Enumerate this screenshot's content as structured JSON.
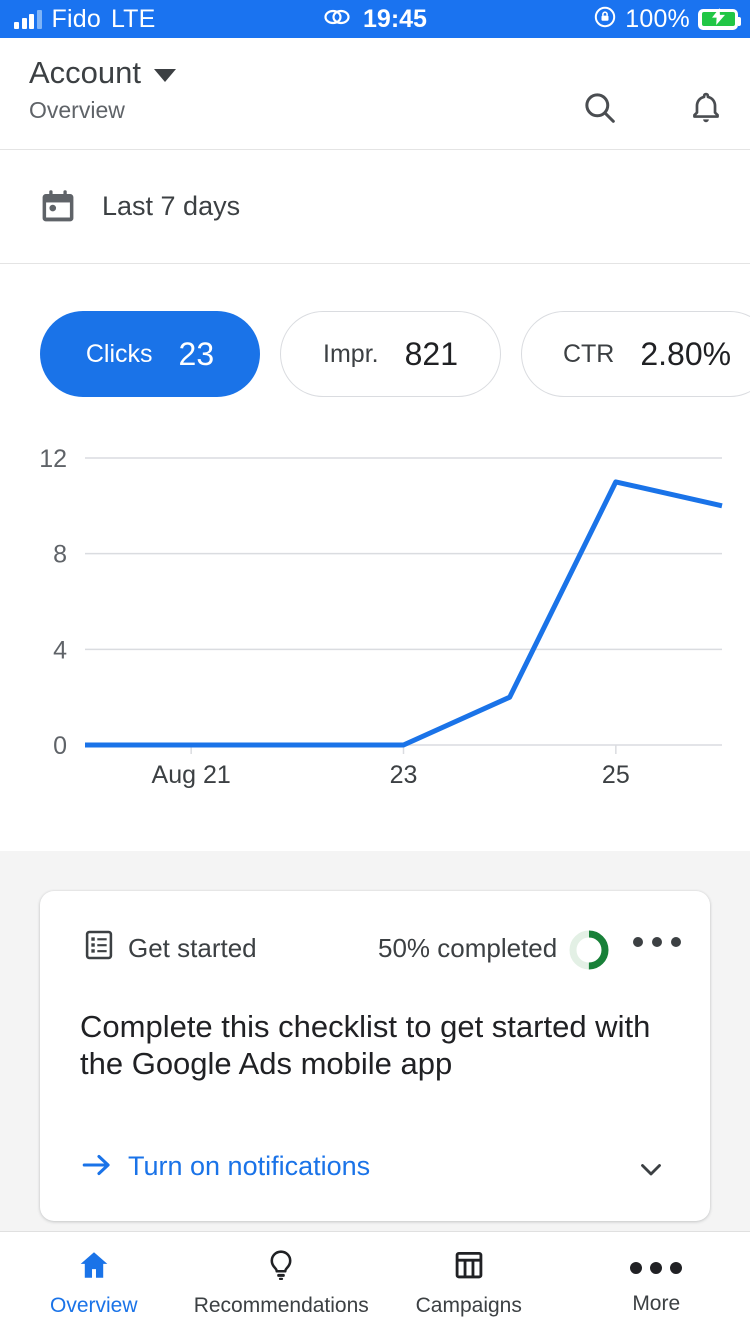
{
  "status_bar": {
    "carrier": "Fido",
    "network": "LTE",
    "time": "19:45",
    "battery_percent": "100%",
    "signal_icon": "signal-bars-icon",
    "link_icon": "link-icon",
    "rotation_lock_icon": "rotation-lock-icon",
    "battery_icon": "battery-charging-icon",
    "background_color": "#1a73f0"
  },
  "header": {
    "title": "Account",
    "subtitle": "Overview",
    "dropdown_icon": "chevron-down-icon",
    "search_icon": "search-icon",
    "notifications_icon": "bell-icon"
  },
  "date_range": {
    "label": "Last 7 days",
    "icon": "calendar-icon"
  },
  "metrics": [
    {
      "key": "Clicks",
      "value": "23",
      "selected": true
    },
    {
      "key": "Impr.",
      "value": "821",
      "selected": false
    },
    {
      "key": "CTR",
      "value": "2.80%",
      "selected": false
    }
  ],
  "chart_data": {
    "type": "line",
    "title": "Clicks",
    "xlabel": "",
    "ylabel": "",
    "grid": true,
    "legend": false,
    "line_color": "#1a73e8",
    "x": [
      "Aug 20",
      "Aug 21",
      "Aug 22",
      "Aug 23",
      "Aug 24",
      "Aug 25",
      "Aug 26"
    ],
    "x_tick_labels": [
      "Aug 21",
      "23",
      "25"
    ],
    "x_tick_indices": [
      1,
      3,
      5
    ],
    "y_tick_labels": [
      "0",
      "4",
      "8",
      "12"
    ],
    "ylim": [
      0,
      12
    ],
    "values": [
      0,
      0,
      0,
      0,
      2,
      11,
      10
    ]
  },
  "get_started_card": {
    "icon": "checklist-icon",
    "title": "Get started",
    "progress_label": "50% completed",
    "progress_percent": 50,
    "progress_color": "#188038",
    "progress_track_color": "#e3f0e5",
    "overflow_icon": "more-horizontal-icon",
    "headline": "Complete this checklist to get started with the Google Ads mobile app",
    "cta_arrow_icon": "arrow-right-icon",
    "cta_label": "Turn on notifications",
    "expand_icon": "chevron-down-icon"
  },
  "bottom_nav": {
    "items": [
      {
        "label": "Overview",
        "icon": "home-icon",
        "active": true
      },
      {
        "label": "Recommendations",
        "icon": "lightbulb-icon",
        "active": false
      },
      {
        "label": "Campaigns",
        "icon": "table-icon",
        "active": false
      },
      {
        "label": "More",
        "icon": "more-horizontal-icon",
        "active": false
      }
    ]
  },
  "colors": {
    "accent": "#1a73e8",
    "status_bar": "#1a73f0",
    "green": "#188038"
  }
}
